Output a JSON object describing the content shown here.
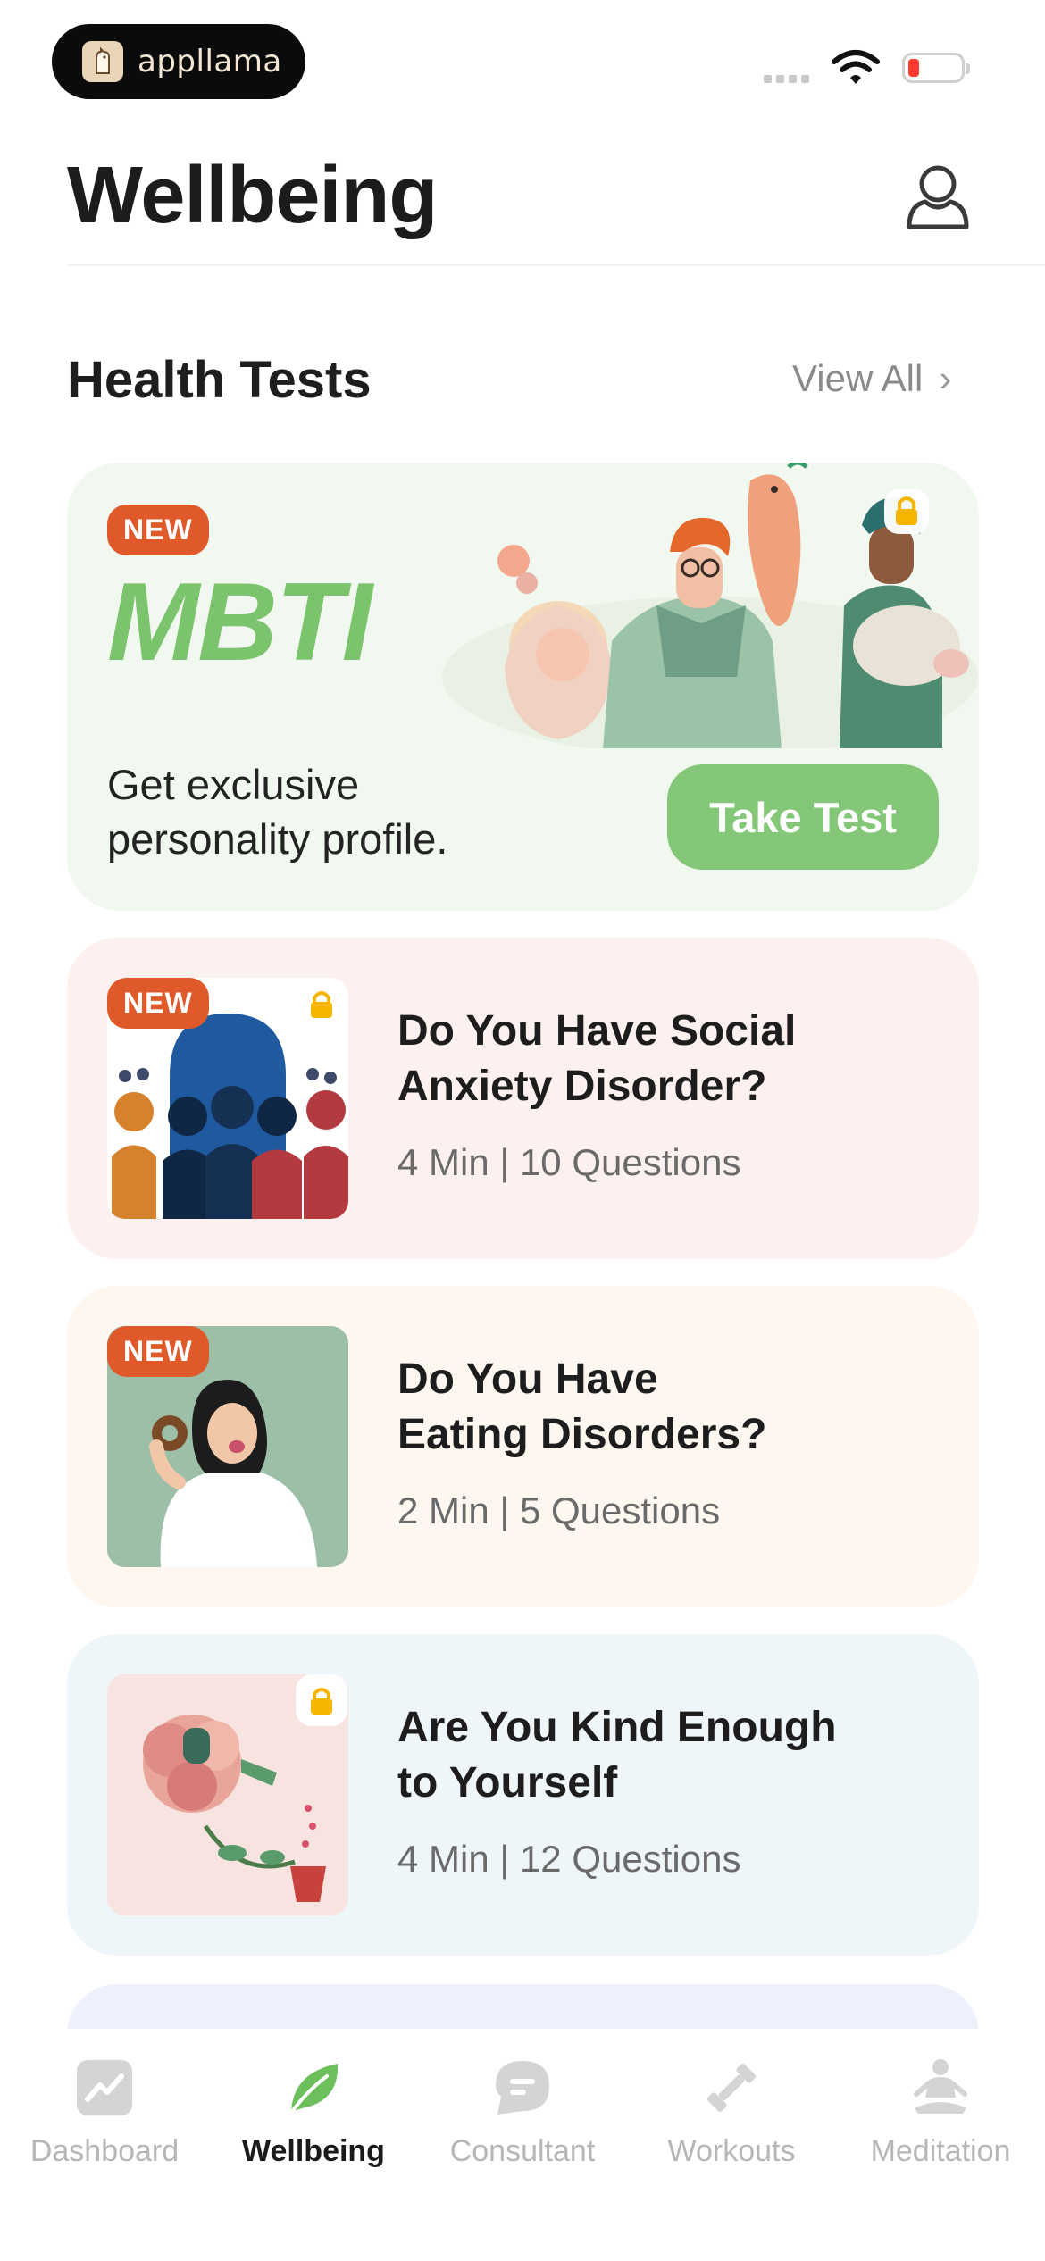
{
  "status_bar": {
    "app_name": "appllama"
  },
  "header": {
    "title": "Wellbeing"
  },
  "section": {
    "title": "Health Tests",
    "view_all_label": "View All",
    "view_all_chevron": "›"
  },
  "featured_test": {
    "badge": "NEW",
    "name": "MBTI",
    "description": "Get exclusive personality profile.",
    "button_label": "Take Test",
    "accent_color": "#7cc36d",
    "background_color": "#f1f8ef",
    "locked": true
  },
  "tests": [
    {
      "badge": "NEW",
      "title_line1": "Do You Have Social",
      "title_line2": "Anxiety Disorder?",
      "meta": "4 Min | 10 Questions",
      "locked": true,
      "background_color": "#fdf1ef"
    },
    {
      "badge": "NEW",
      "title_line1": "Do You Have",
      "title_line2": "Eating Disorders?",
      "meta": "2 Min | 5 Questions",
      "locked": false,
      "background_color": "#fdf7ef"
    },
    {
      "badge": "",
      "title_line1": "Are You Kind Enough",
      "title_line2": "to Yourself",
      "meta": "4 Min | 12 Questions",
      "locked": true,
      "background_color": "#eef6f9"
    }
  ],
  "tab_bar": {
    "items": [
      {
        "label": "Dashboard",
        "icon": "chart-icon",
        "active": false
      },
      {
        "label": "Wellbeing",
        "icon": "leaf-icon",
        "active": true
      },
      {
        "label": "Consultant",
        "icon": "chat-bubble-icon",
        "active": false
      },
      {
        "label": "Workouts",
        "icon": "dumbbell-icon",
        "active": false
      },
      {
        "label": "Meditation",
        "icon": "meditation-icon",
        "active": false
      }
    ]
  },
  "colors": {
    "badge": "#e0592a",
    "lock": "#f5b400",
    "active_tab_icon": "#6cbf5a",
    "inactive_tab": "#b6b6b6"
  }
}
